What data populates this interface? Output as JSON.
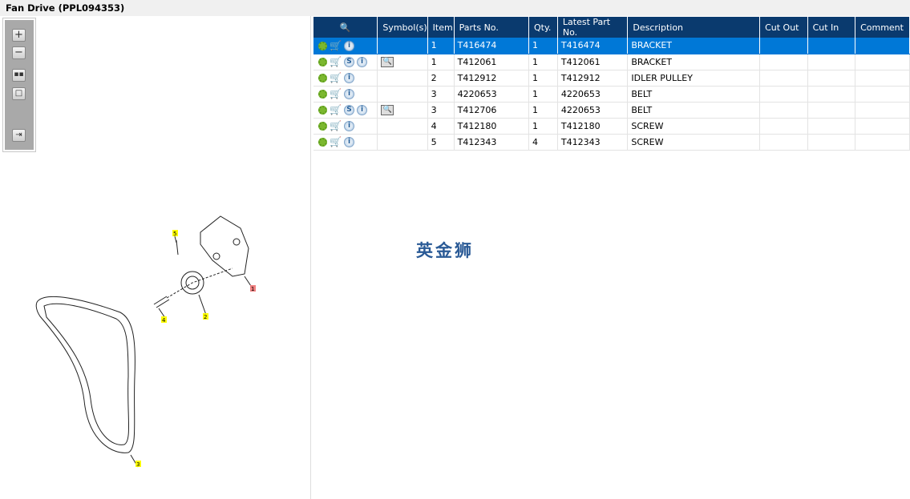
{
  "window": {
    "title": "Fan Drive (PPL094353)"
  },
  "toolbar": {
    "icons": [
      "zoom-in-icon",
      "zoom-out-icon",
      "fit-all-icon",
      "actual-size-icon",
      "toggle-list-icon"
    ]
  },
  "diagram": {
    "callouts": [
      "5",
      "1",
      "2",
      "4",
      "3"
    ]
  },
  "table": {
    "headers": [
      "",
      "Symbol(s)",
      "Item",
      "Parts No.",
      "Qty.",
      "Latest Part No.",
      "Description",
      "Cut Out",
      "Cut In",
      "Comment"
    ],
    "rows": [
      {
        "item": "1",
        "part": "T416474",
        "qty": "1",
        "latest": "T416474",
        "desc": "BRACKET",
        "s": false,
        "book": false,
        "selected": true
      },
      {
        "item": "1",
        "part": "T412061",
        "qty": "1",
        "latest": "T412061",
        "desc": "BRACKET",
        "s": true,
        "book": true,
        "selected": false
      },
      {
        "item": "2",
        "part": "T412912",
        "qty": "1",
        "latest": "T412912",
        "desc": "IDLER PULLEY",
        "s": false,
        "book": false,
        "selected": false
      },
      {
        "item": "3",
        "part": "4220653",
        "qty": "1",
        "latest": "4220653",
        "desc": "BELT",
        "s": false,
        "book": false,
        "selected": false
      },
      {
        "item": "3",
        "part": "T412706",
        "qty": "1",
        "latest": "4220653",
        "desc": "BELT",
        "s": true,
        "book": true,
        "selected": false
      },
      {
        "item": "4",
        "part": "T412180",
        "qty": "1",
        "latest": "T412180",
        "desc": "SCREW",
        "s": false,
        "book": false,
        "selected": false
      },
      {
        "item": "5",
        "part": "T412343",
        "qty": "4",
        "latest": "T412343",
        "desc": "SCREW",
        "s": false,
        "book": false,
        "selected": false
      }
    ],
    "badge_s": "S",
    "badge_i": "i"
  },
  "watermark": "英金狮",
  "colors": {
    "header": "#0a3a6e",
    "selected": "#0078d7",
    "callout_yellow": "#ffff00",
    "callout_red": "#f08080"
  }
}
